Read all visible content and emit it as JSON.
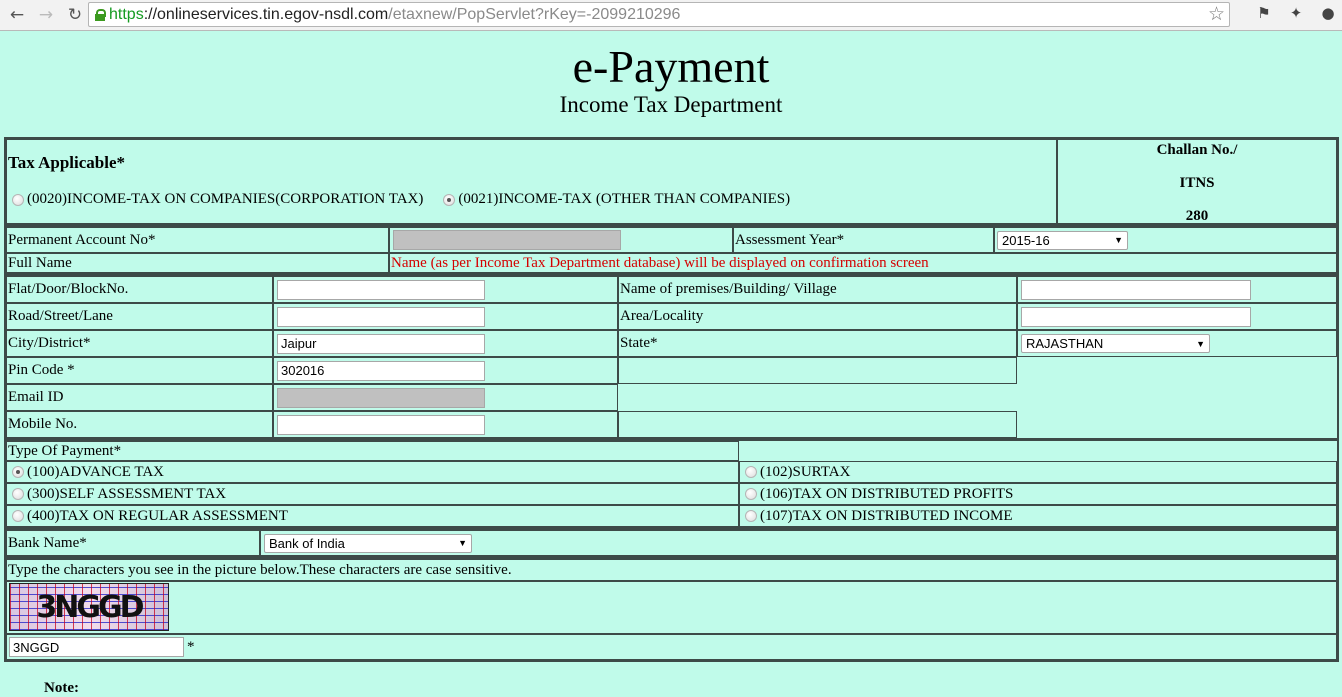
{
  "browser": {
    "url_scheme": "https",
    "url_host": "://onlineservices.tin.egov-nsdl.com",
    "url_path": "/etaxnew/PopServlet?rKey=-2099210296",
    "icons": [
      "back-icon",
      "forward-icon",
      "reload-icon",
      "lock-icon",
      "bookmark-star-icon",
      "extensions-icon",
      "lamp-extension-icon",
      "evernote-icon"
    ]
  },
  "header": {
    "title": "e-Payment",
    "subtitle": "Income Tax Department"
  },
  "tax_applicable": {
    "label": "Tax Applicable*",
    "options": [
      {
        "label": "(0020)INCOME-TAX ON COMPANIES(CORPORATION TAX)",
        "checked": false
      },
      {
        "label": "(0021)INCOME-TAX (OTHER THAN COMPANIES)",
        "checked": true
      }
    ],
    "challan": {
      "line1": "Challan No./",
      "line2": "ITNS",
      "line3": "280"
    }
  },
  "pan": {
    "label": "Permanent Account No*",
    "value": ""
  },
  "assessment_year": {
    "label": "Assessment Year*",
    "value": "2015-16"
  },
  "full_name": {
    "label": "Full Name",
    "note": "Name (as per Income Tax Department database) will be displayed on confirmation screen"
  },
  "address": {
    "flat": {
      "label": "Flat/Door/BlockNo.",
      "value": ""
    },
    "premises": {
      "label": "Name of premises/Building/ Village",
      "value": ""
    },
    "road": {
      "label": "Road/Street/Lane",
      "value": ""
    },
    "area": {
      "label": "Area/Locality",
      "value": ""
    },
    "city": {
      "label": "City/District*",
      "value": "Jaipur"
    },
    "state": {
      "label": "State*",
      "value": "RAJASTHAN"
    },
    "pin": {
      "label": "Pin Code *",
      "value": "302016"
    },
    "email": {
      "label": "Email ID",
      "value": ""
    },
    "mobile": {
      "label": "Mobile No.",
      "value": ""
    }
  },
  "payment_type": {
    "label": "Type Of Payment*",
    "options": [
      {
        "label": "(100)ADVANCE TAX",
        "checked": true
      },
      {
        "label": "(102)SURTAX",
        "checked": false
      },
      {
        "label": "(300)SELF ASSESSMENT TAX",
        "checked": false
      },
      {
        "label": "(106)TAX ON DISTRIBUTED PROFITS",
        "checked": false
      },
      {
        "label": "(400)TAX ON REGULAR ASSESSMENT",
        "checked": false
      },
      {
        "label": "(107)TAX ON DISTRIBUTED INCOME",
        "checked": false
      }
    ]
  },
  "bank": {
    "label": "Bank Name*",
    "value": "Bank of India"
  },
  "captcha": {
    "instruction": "Type the characters you see in the picture below.These characters are case sensitive.",
    "image_text": "3NGGD",
    "value": "3NGGD",
    "required_mark": "*"
  },
  "note": {
    "label": "Note:"
  }
}
